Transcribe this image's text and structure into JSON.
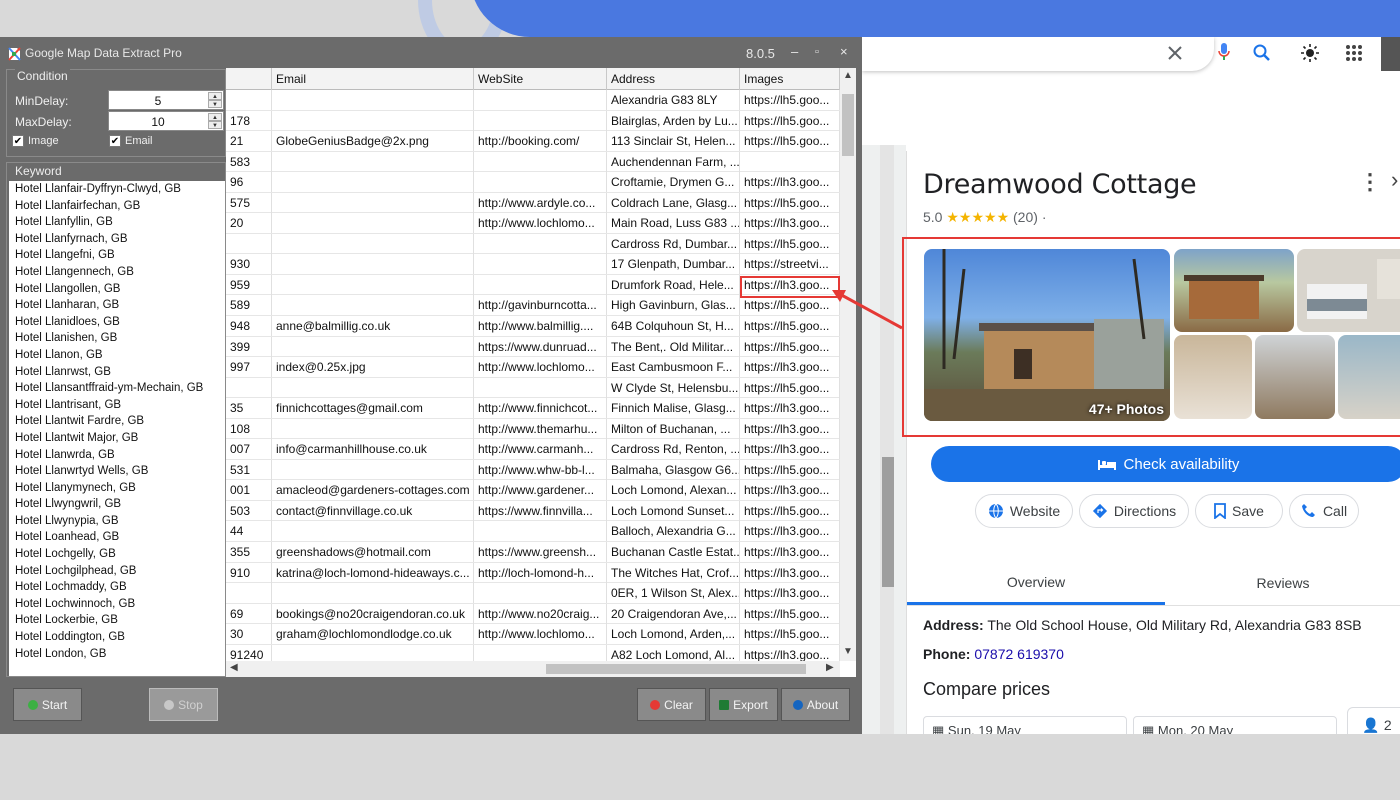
{
  "app": {
    "title": "Google Map Data Extract Pro",
    "version": "8.0.5",
    "window_buttons": [
      "‒",
      "▫",
      "×"
    ]
  },
  "condition": {
    "legend": "Condition",
    "min_delay_label": "MinDelay:",
    "min_delay_value": "5",
    "max_delay_label": "MaxDelay:",
    "max_delay_value": "10",
    "image_label": "Image",
    "image_checked": true,
    "email_label": "Email",
    "email_checked": true
  },
  "keyword": {
    "legend": "Keyword",
    "items": [
      "Hotel  Llanfair-Dyffryn-Clwyd, GB",
      "Hotel  Llanfairfechan, GB",
      "Hotel  Llanfyllin, GB",
      "Hotel  Llanfyrnach, GB",
      "Hotel  Llangefni, GB",
      "Hotel  Llangennech, GB",
      "Hotel  Llangollen, GB",
      "Hotel  Llanharan, GB",
      "Hotel  Llanidloes, GB",
      "Hotel  Llanishen, GB",
      "Hotel  Llanon, GB",
      "Hotel  Llanrwst, GB",
      "Hotel  Llansantffraid-ym-Mechain, GB",
      "Hotel  Llantrisant, GB",
      "Hotel  Llantwit Fardre, GB",
      "Hotel  Llantwit Major, GB",
      "Hotel  Llanwrda, GB",
      "Hotel  Llanwrtyd Wells, GB",
      "Hotel  Llanymynech, GB",
      "Hotel  Llwyngwril, GB",
      "Hotel  Llwynypia, GB",
      "Hotel  Loanhead, GB",
      "Hotel  Lochgelly, GB",
      "Hotel  Lochgilphead, GB",
      "Hotel  Lochmaddy, GB",
      "Hotel  Lochwinnoch, GB",
      "Hotel  Lockerbie, GB",
      "Hotel  Loddington, GB",
      "Hotel  London, GB"
    ]
  },
  "grid": {
    "columns": [
      "",
      "Email",
      "WebSite",
      "Address",
      "Images"
    ],
    "rows": [
      [
        "",
        "",
        "",
        "Alexandria G83 8LY",
        "https://lh5.goo..."
      ],
      [
        "178",
        "",
        "",
        "Blairglas, Arden by Lu...",
        "https://lh5.goo..."
      ],
      [
        "21",
        "GlobeGeniusBadge@2x.png",
        "http://booking.com/",
        "113 Sinclair St, Helen...",
        "https://lh5.goo..."
      ],
      [
        "583",
        "",
        "",
        "Auchendennan Farm, ...",
        ""
      ],
      [
        "96",
        "",
        "",
        "Croftamie, Drymen G...",
        "https://lh3.goo..."
      ],
      [
        "575",
        "",
        "http://www.ardyle.co...",
        "Coldrach Lane, Glasg...",
        "https://lh5.goo..."
      ],
      [
        "20",
        "",
        "http://www.lochlomo...",
        "Main Road, Luss G83 ...",
        "https://lh3.goo..."
      ],
      [
        "",
        "",
        "",
        "Cardross Rd, Dumbar...",
        "https://lh5.goo..."
      ],
      [
        "930",
        "",
        "",
        "17 Glenpath, Dumbar...",
        "https://streetvi..."
      ],
      [
        "959",
        "",
        "",
        "Drumfork Road, Hele...",
        "https://lh3.goo..."
      ],
      [
        "589",
        "",
        "http://gavinburncotta...",
        "High Gavinburn, Glas...",
        "https://lh5.goo..."
      ],
      [
        "948",
        "anne@balmillig.co.uk",
        "http://www.balmillig....",
        "64B Colquhoun St, H...",
        "https://lh5.goo..."
      ],
      [
        "399",
        "",
        "https://www.dunruad...",
        "The Bent,. Old Militar...",
        "https://lh5.goo..."
      ],
      [
        "997",
        "index@0.25x.jpg",
        "http://www.lochlomo...",
        "East Cambusmoon F...",
        "https://lh3.goo..."
      ],
      [
        "",
        "",
        "",
        "W Clyde St, Helensbu...",
        "https://lh5.goo..."
      ],
      [
        "35",
        "finnichcottages@gmail.com",
        "http://www.finnichcot...",
        "Finnich Malise, Glasg...",
        "https://lh3.goo..."
      ],
      [
        "108",
        "",
        "http://www.themarhu...",
        "Milton of Buchanan, ...",
        "https://lh3.goo..."
      ],
      [
        "007",
        "info@carmanhillhouse.co.uk",
        "http://www.carmanh...",
        "Cardross Rd, Renton, ...",
        "https://lh3.goo..."
      ],
      [
        "531",
        "",
        "http://www.whw-bb-l...",
        "Balmaha, Glasgow G6...",
        "https://lh5.goo..."
      ],
      [
        "001",
        "amacleod@gardeners-cottages.com",
        "http://www.gardener...",
        "Loch Lomond, Alexan...",
        "https://lh3.goo..."
      ],
      [
        "503",
        "contact@finnvillage.co.uk",
        "https://www.finnvilla...",
        "Loch Lomond Sunset...",
        "https://lh5.goo..."
      ],
      [
        "44",
        "",
        "",
        "Balloch, Alexandria G...",
        "https://lh3.goo..."
      ],
      [
        "355",
        "greenshadows@hotmail.com",
        "https://www.greensh...",
        "Buchanan Castle Estat...",
        "https://lh3.goo..."
      ],
      [
        "910",
        "katrina@loch-lomond-hideaways.c...",
        "http://loch-lomond-h...",
        "The Witches Hat, Crof...",
        "https://lh3.goo..."
      ],
      [
        "",
        "",
        "",
        "0ER, 1 Wilson St, Alex...",
        "https://lh3.goo..."
      ],
      [
        "69",
        "bookings@no20craigendoran.co.uk",
        "http://www.no20craig...",
        "20 Craigendoran Ave,...",
        "https://lh5.goo..."
      ],
      [
        "30",
        "graham@lochlomondlodge.co.uk",
        "http://www.lochlomo...",
        "Loch Lomond, Arden,...",
        "https://lh5.goo..."
      ],
      [
        "91240",
        "",
        "",
        "A82 Loch Lomond, Al...",
        "https://lh3.goo..."
      ]
    ]
  },
  "buttons": {
    "start": "Start",
    "stop": "Stop",
    "clear": "Clear",
    "export": "Export",
    "about": "About"
  },
  "gmaps": {
    "place_name": "Dreamwood Cottage",
    "rating": "5.0",
    "stars": 5,
    "review_count": "(20)",
    "photo_count": "47+ Photos",
    "check_availability": "Check availability",
    "actions": [
      "Website",
      "Directions",
      "Save",
      "Call"
    ],
    "tabs": [
      "Overview",
      "Reviews"
    ],
    "address_label": "Address:",
    "address_value": "The Old School House, Old Military Rd, Alexandria G83 8SB",
    "phone_label": "Phone:",
    "phone_value": "07872 619370",
    "compare_prices": "Compare prices",
    "check_in": "Sun, 19 May",
    "check_out": "Mon, 20 May",
    "guests": "2",
    "colors": {
      "accent": "#1a73e8",
      "highlight": "#e53935",
      "star": "#f4b400"
    }
  }
}
